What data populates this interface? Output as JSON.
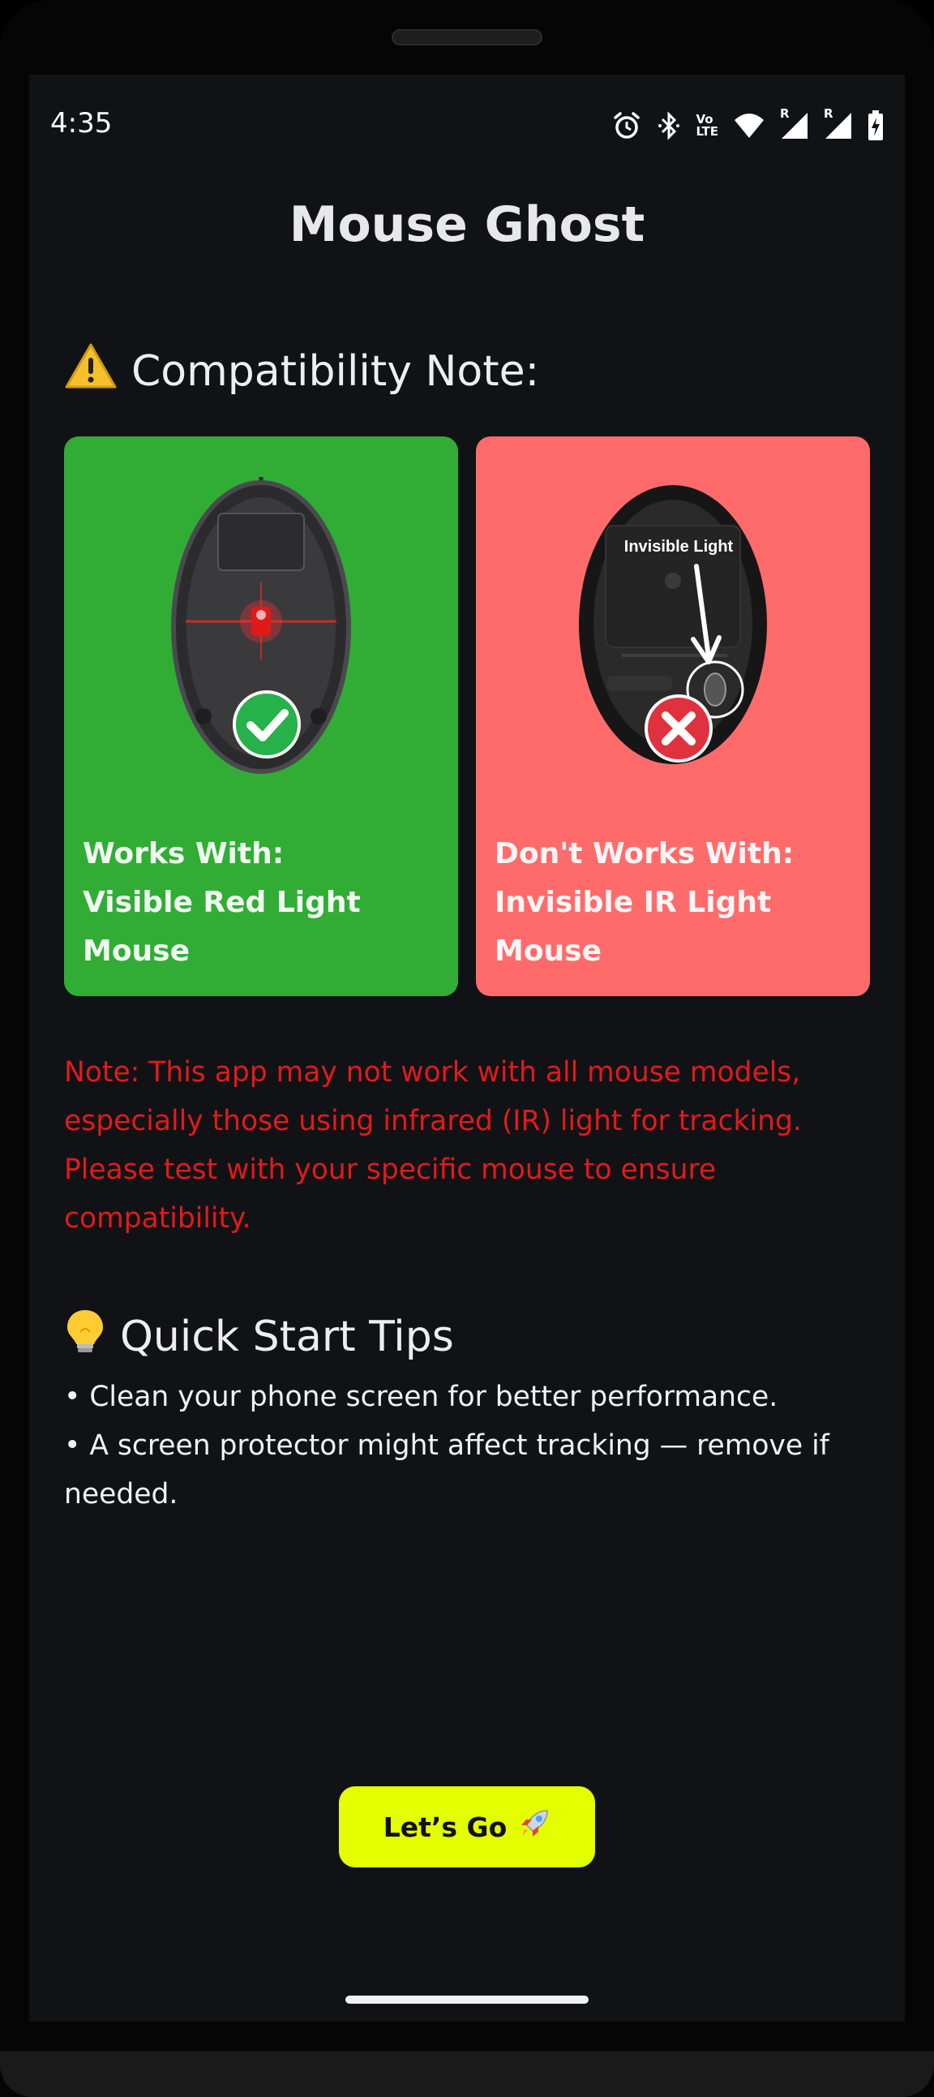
{
  "status_bar": {
    "time": "4:35",
    "icons": [
      "alarm-icon",
      "bluetooth-icon",
      "volte-icon",
      "wifi-icon",
      "signal-icon",
      "signal-icon",
      "battery-charging-icon"
    ],
    "volte_top": "Vo",
    "volte_bottom": "LTE",
    "roaming": "R"
  },
  "app": {
    "title": "Mouse Ghost"
  },
  "compatibility": {
    "heading": "Compatibility Note:",
    "heading_icon": "warning-icon",
    "works_card": {
      "bg_color": "#31ad36",
      "badge_icon": "check-icon",
      "line1": "Works With:",
      "line2": "Visible Red Light",
      "line3": "Mouse"
    },
    "not_works_card": {
      "bg_color": "#ff6b6b",
      "badge_icon": "cross-icon",
      "image_label": "Invisible Light",
      "line1": "Don't Works With:",
      "line2": "Invisible IR Light",
      "line3": "Mouse"
    }
  },
  "note": {
    "text": "Note: This app may not work with all mouse models, especially those using infrared (IR) light for tracking. Please test with your specific mouse to ensure compatibility.",
    "color": "#e11b1b"
  },
  "tips": {
    "heading": "Quick Start Tips",
    "heading_icon": "lightbulb-icon",
    "items": [
      "• Clean your phone screen for better performance.",
      "• A screen protector might affect tracking — remove if needed."
    ]
  },
  "cta": {
    "label": "Let’s Go",
    "icon": "rocket-icon",
    "color": "#e3ff00"
  }
}
